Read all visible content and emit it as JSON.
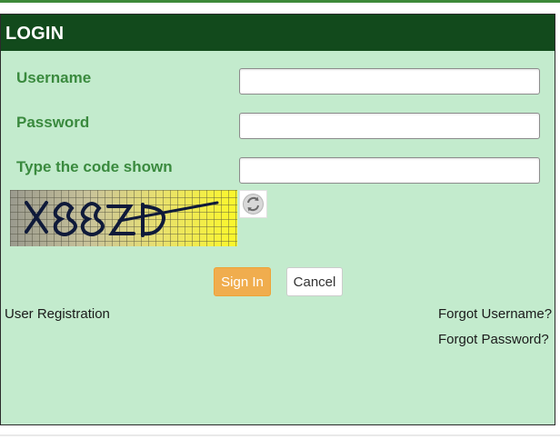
{
  "login": {
    "title": "LOGIN",
    "fields": {
      "username": {
        "label": "Username",
        "value": "",
        "placeholder": ""
      },
      "password": {
        "label": "Password",
        "value": "",
        "placeholder": ""
      },
      "captcha": {
        "label": "Type the code shown",
        "value": "",
        "placeholder": ""
      }
    },
    "captcha_code": "X88ZD",
    "buttons": {
      "sign_in": "Sign In",
      "cancel": "Cancel"
    },
    "links": {
      "user_registration": "User Registration",
      "forgot_username": "Forgot Username?",
      "forgot_password": "Forgot Password?"
    }
  },
  "colors": {
    "header_bg": "#124a1c",
    "panel_bg": "#c3ebcd",
    "label_text": "#3a8a3e",
    "sign_in_bg": "#f0ad4e",
    "top_line": "#3d8a3a"
  },
  "icons": {
    "refresh": "refresh-captcha-icon"
  }
}
